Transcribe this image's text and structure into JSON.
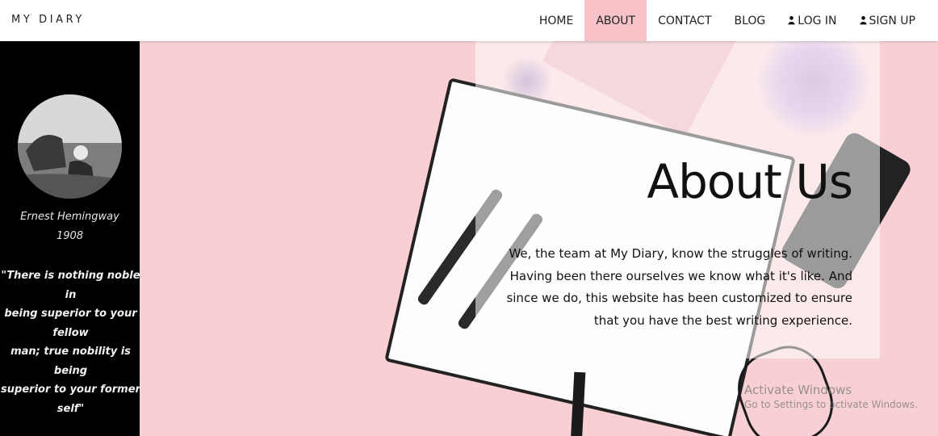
{
  "navbar": {
    "brand": "MY DIARY",
    "items": [
      {
        "label": "HOME",
        "active": false,
        "icon": null
      },
      {
        "label": "ABOUT",
        "active": true,
        "icon": null
      },
      {
        "label": "CONTACT",
        "active": false,
        "icon": null
      },
      {
        "label": "BLOG",
        "active": false,
        "icon": null
      },
      {
        "label": "LOG IN",
        "active": false,
        "icon": "user-icon"
      },
      {
        "label": "SIGN UP",
        "active": false,
        "icon": "user-icon"
      }
    ],
    "active_color": "#f7c3c9"
  },
  "sidebar": {
    "author": "Ernest Hemingway",
    "year": "1908",
    "quote_lines": [
      "\"There is nothing noble in",
      "being superior to your fellow",
      "man; true nobility is being",
      "superior to your former self\""
    ]
  },
  "about": {
    "title": "About Us",
    "lines": [
      "We, the team at My Diary, know the struggles of writing.",
      "Having been there ourselves we know what it's like. And",
      "since we do, this website has been customized to ensure",
      "that you have the best writing experience."
    ]
  },
  "watermark": {
    "title": "Activate Windows",
    "subtitle": "Go to Settings to activate Windows."
  }
}
